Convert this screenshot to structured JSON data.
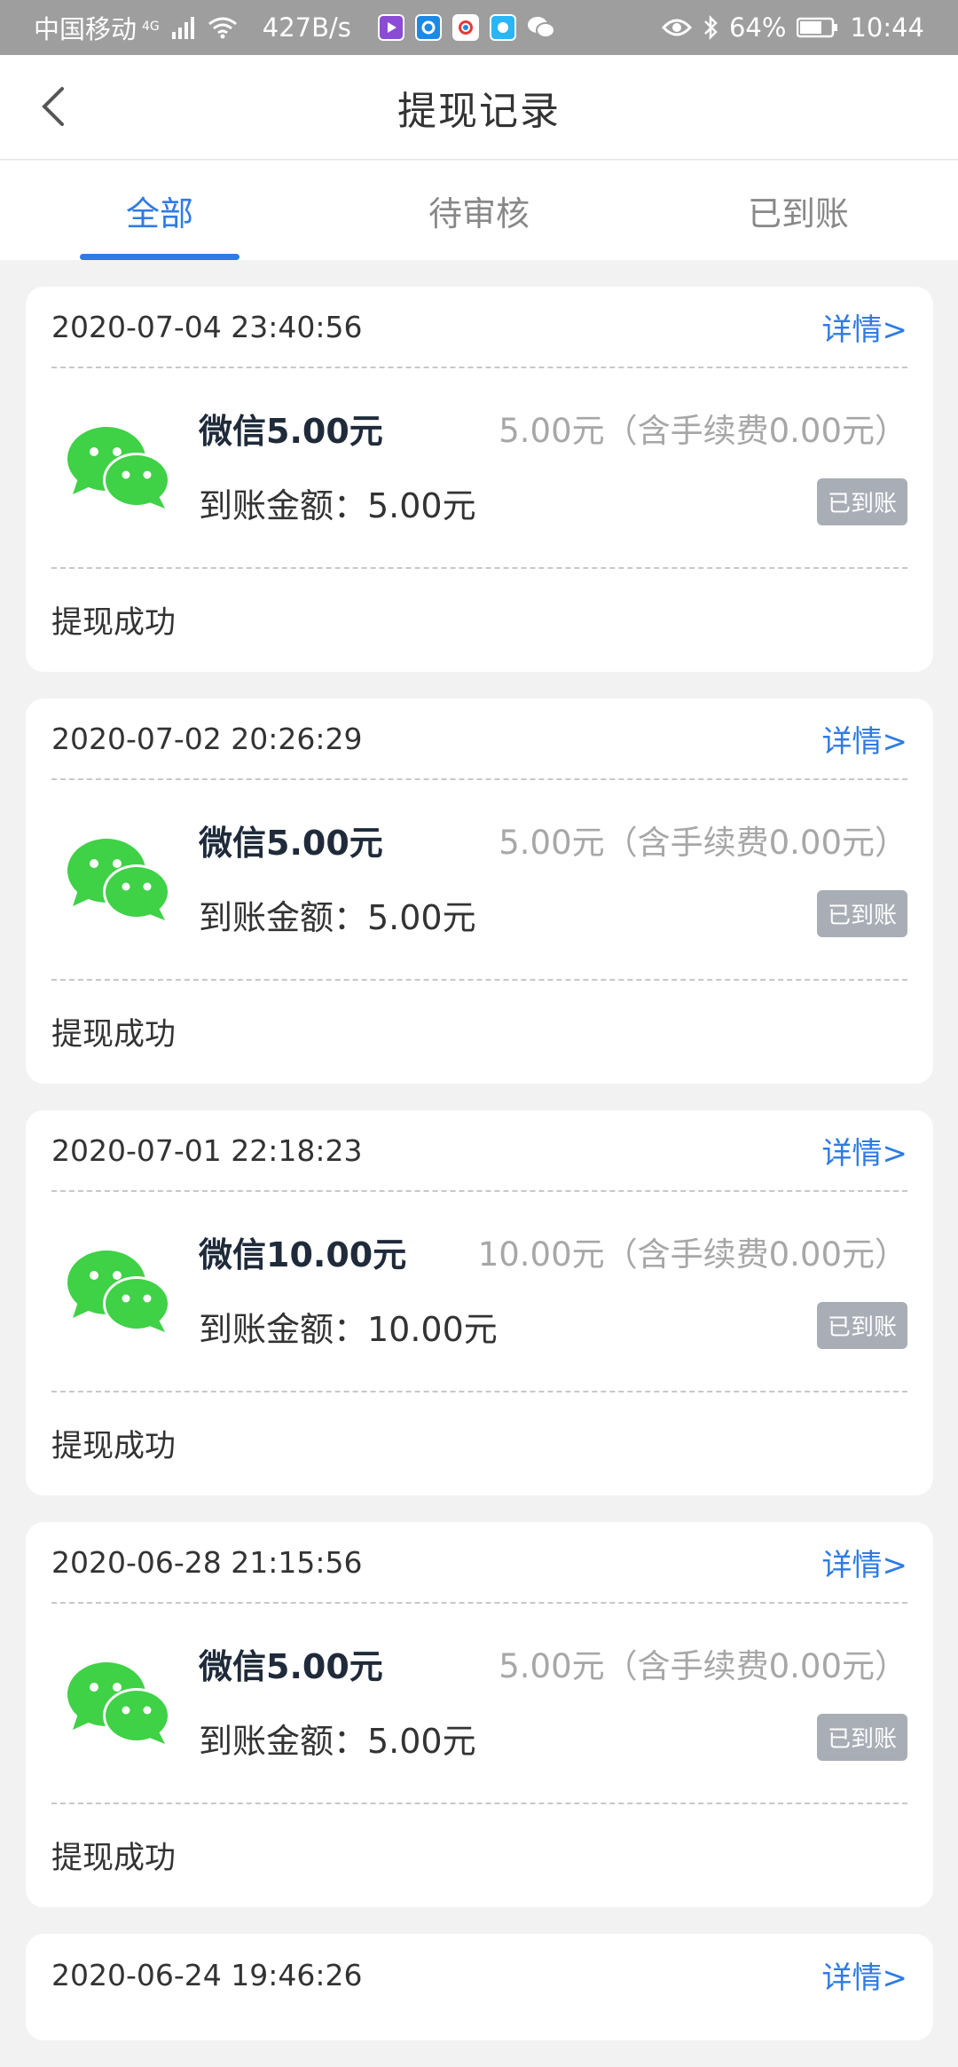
{
  "status_bar": {
    "carrier": "中国移动",
    "network": "4G",
    "speed": "427B/s",
    "battery": "64%",
    "time": "10:44"
  },
  "nav": {
    "title": "提现记录"
  },
  "tabs": [
    {
      "label": "全部",
      "active": true
    },
    {
      "label": "待审核",
      "active": false
    },
    {
      "label": "已到账",
      "active": false
    }
  ],
  "records": [
    {
      "time": "2020-07-04 23:40:56",
      "detail_label": "详情>",
      "title": "微信5.00元",
      "fee_text": "5.00元（含手续费0.00元）",
      "arrive_text": "到账金额：5.00元",
      "badge": "已到账",
      "result": "提现成功"
    },
    {
      "time": "2020-07-02 20:26:29",
      "detail_label": "详情>",
      "title": "微信5.00元",
      "fee_text": "5.00元（含手续费0.00元）",
      "arrive_text": "到账金额：5.00元",
      "badge": "已到账",
      "result": "提现成功"
    },
    {
      "time": "2020-07-01 22:18:23",
      "detail_label": "详情>",
      "title": "微信10.00元",
      "fee_text": "10.00元（含手续费0.00元）",
      "arrive_text": "到账金额：10.00元",
      "badge": "已到账",
      "result": "提现成功"
    },
    {
      "time": "2020-06-28 21:15:56",
      "detail_label": "详情>",
      "title": "微信5.00元",
      "fee_text": "5.00元（含手续费0.00元）",
      "arrive_text": "到账金额：5.00元",
      "badge": "已到账",
      "result": "提现成功"
    },
    {
      "time": "2020-06-24 19:46:26",
      "detail_label": "详情>"
    }
  ],
  "colors": {
    "accent": "#2f7be5",
    "wechat_green": "#3fd146",
    "badge_bg": "#a9adb6"
  },
  "icons": {
    "back": "chevron-left-icon",
    "wechat": "wechat-icon"
  }
}
